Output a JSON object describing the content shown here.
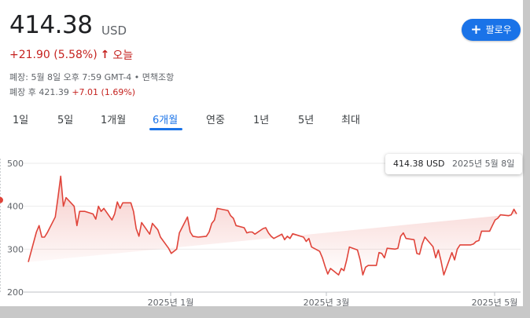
{
  "quote": {
    "price": "414.38",
    "currency": "USD",
    "change": "+21.90 (5.58%)",
    "change_arrow": "↑",
    "change_period": "오늘",
    "close_info": "폐장: 5월 8일 오후 7:59 GMT-4 • 면책조항",
    "after_hours_label": "폐장 후 421.39",
    "after_hours_change": "+7.01 (1.69%)"
  },
  "follow_button": {
    "label": "팔로우",
    "icon": "plus-icon"
  },
  "tabs": [
    {
      "label": "1일",
      "active": false
    },
    {
      "label": "5일",
      "active": false
    },
    {
      "label": "1개월",
      "active": false
    },
    {
      "label": "6개월",
      "active": true
    },
    {
      "label": "연중",
      "active": false
    },
    {
      "label": "1년",
      "active": false
    },
    {
      "label": "5년",
      "active": false
    },
    {
      "label": "최대",
      "active": false
    }
  ],
  "tooltip": {
    "value": "414.38 USD",
    "date": "2025년 5월 8일"
  },
  "colors": {
    "line": "#e0443a",
    "active_tab": "#1a73e8",
    "negative": "#c5221f"
  },
  "chart_data": {
    "type": "area",
    "title": "",
    "xlabel": "",
    "ylabel": "",
    "ylim": [
      200,
      500
    ],
    "yticks": [
      500,
      400,
      300,
      200
    ],
    "xticks": [
      "2025년 1월",
      "2025년 3월",
      "2025년 5월"
    ],
    "x": [
      "2024-11-08",
      "2024-11-11",
      "2024-11-12",
      "2024-11-13",
      "2024-11-14",
      "2024-11-15",
      "2024-11-18",
      "2024-11-19",
      "2024-11-20",
      "2024-11-21",
      "2024-11-22",
      "2024-11-25",
      "2024-11-26",
      "2024-11-27",
      "2024-11-29",
      "2024-12-02",
      "2024-12-03",
      "2024-12-04",
      "2024-12-05",
      "2024-12-06",
      "2024-12-09",
      "2024-12-10",
      "2024-12-11",
      "2024-12-12",
      "2024-12-13",
      "2024-12-16",
      "2024-12-17",
      "2024-12-18",
      "2024-12-19",
      "2024-12-20",
      "2024-12-23",
      "2024-12-24",
      "2024-12-26",
      "2024-12-27",
      "2024-12-30",
      "2024-12-31",
      "2025-01-02",
      "2025-01-03",
      "2025-01-06",
      "2025-01-07",
      "2025-01-08",
      "2025-01-10",
      "2025-01-13",
      "2025-01-14",
      "2025-01-15",
      "2025-01-16",
      "2025-01-17",
      "2025-01-21",
      "2025-01-22",
      "2025-01-23",
      "2025-01-24",
      "2025-01-27",
      "2025-01-28",
      "2025-01-29",
      "2025-01-30",
      "2025-01-31",
      "2025-02-03",
      "2025-02-04",
      "2025-02-05",
      "2025-02-06",
      "2025-02-07",
      "2025-02-10",
      "2025-02-11",
      "2025-02-12",
      "2025-02-13",
      "2025-02-14",
      "2025-02-18",
      "2025-02-19",
      "2025-02-20",
      "2025-02-21",
      "2025-02-24",
      "2025-02-25",
      "2025-02-26",
      "2025-02-27",
      "2025-02-28",
      "2025-03-03",
      "2025-03-04",
      "2025-03-05",
      "2025-03-06",
      "2025-03-07",
      "2025-03-10",
      "2025-03-11",
      "2025-03-12",
      "2025-03-13",
      "2025-03-14",
      "2025-03-17",
      "2025-03-18",
      "2025-03-19",
      "2025-03-20",
      "2025-03-21",
      "2025-03-24",
      "2025-03-25",
      "2025-03-26",
      "2025-03-27",
      "2025-03-28",
      "2025-03-31",
      "2025-04-01",
      "2025-04-02",
      "2025-04-03",
      "2025-04-04",
      "2025-04-07",
      "2025-04-08",
      "2025-04-09",
      "2025-04-10",
      "2025-04-11",
      "2025-04-14",
      "2025-04-15",
      "2025-04-16",
      "2025-04-17",
      "2025-04-21",
      "2025-04-22",
      "2025-04-23",
      "2025-04-24",
      "2025-04-25",
      "2025-04-28",
      "2025-04-29",
      "2025-04-30",
      "2025-05-01",
      "2025-05-02",
      "2025-05-05",
      "2025-05-06",
      "2025-05-07",
      "2025-05-08"
    ],
    "series": [
      {
        "values": [
          270,
          340,
          355,
          328,
          328,
          338,
          375,
          420,
          470,
          400,
          420,
          400,
          355,
          388,
          388,
          382,
          370,
          400,
          388,
          395,
          368,
          382,
          410,
          395,
          408,
          408,
          388,
          348,
          330,
          362,
          335,
          360,
          345,
          328,
          302,
          290,
          300,
          338,
          375,
          340,
          330,
          328,
          330,
          340,
          360,
          368,
          395,
          390,
          378,
          372,
          355,
          350,
          338,
          340,
          340,
          335,
          348,
          350,
          338,
          330,
          325,
          335,
          322,
          330,
          325,
          336,
          328,
          318,
          325,
          305,
          295,
          280,
          260,
          242,
          255,
          240,
          255,
          250,
          275,
          305,
          298,
          275,
          240,
          258,
          262,
          262,
          292,
          290,
          280,
          302,
          300,
          302,
          330,
          338,
          325,
          322,
          290,
          288,
          312,
          328,
          306,
          280,
          298,
          272,
          240,
          292,
          275,
          300,
          310,
          310,
          312,
          318,
          320,
          342,
          342,
          355,
          368,
          372,
          380,
          378,
          380,
          393,
          382,
          383,
          392,
          414.38
        ]
      }
    ]
  }
}
